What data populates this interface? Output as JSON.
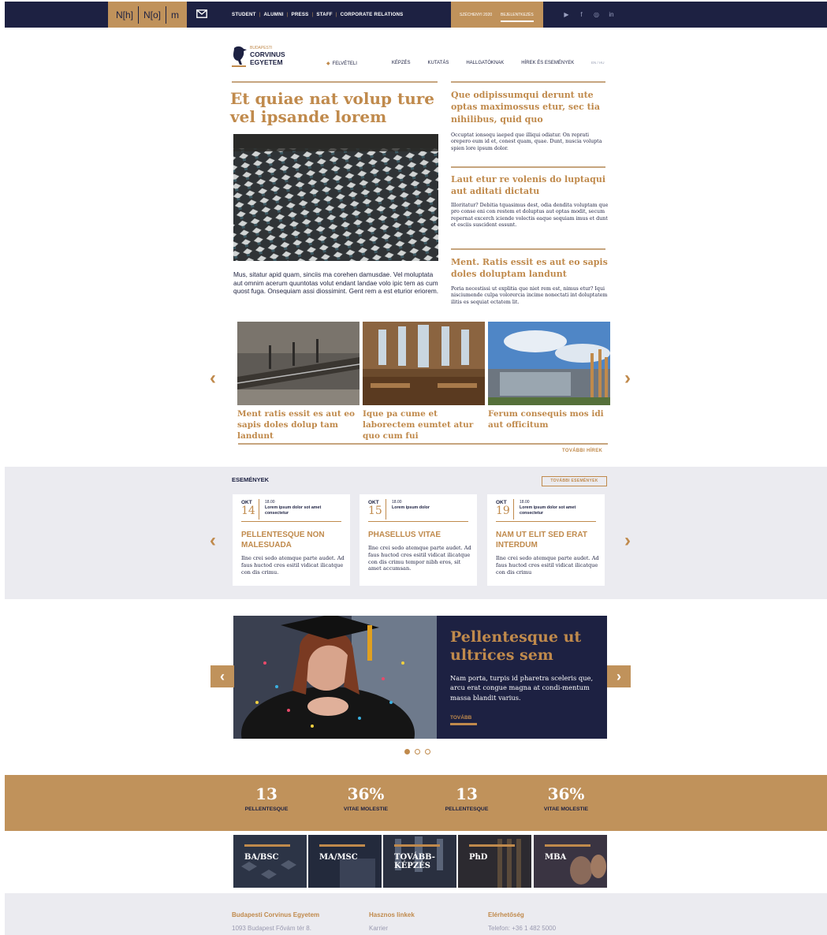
{
  "topbar": {
    "brand_letters": [
      "N[h]",
      "N[o]",
      "m"
    ],
    "links": [
      "STUDENT",
      "ALUMNI",
      "PRESS",
      "STAFF",
      "CORPORATE RELATIONS"
    ],
    "promo_label": "SZÉCHENYI 2020",
    "login_label": "BEJELENTKEZÉS",
    "social_icons": [
      "youtube-icon",
      "facebook-icon",
      "instagram-icon",
      "linkedin-icon"
    ]
  },
  "header": {
    "logo_line1": "BUDAPESTI",
    "logo_line2": "CORVINUS",
    "logo_line3": "EGYETEM",
    "nav": [
      "FELVÉTELI",
      "KÉPZÉS",
      "KUTATÁS",
      "HALLGATÓKNAK",
      "HÍREK ÉS ESEMÉNYEK"
    ],
    "lang": "EN / HU"
  },
  "hero": {
    "title": "Et quiae nat volup ture vel ipsande lorem",
    "text": "Mus, sitatur apid quam, sinciis ma corehen damusdae. Vel moluptata aut omnim acerum quuntotas volut endant landae volo ipic tem as cum quost fuga. Onsequiam assi diossimint. Gent rem a est eturior eriorem."
  },
  "side_news": [
    {
      "title": "Que odipissumqui derunt ute optas maximossus etur, sec tia nihilibus, quid quo",
      "text": "Occuptat ionsequ iaeped que illiqui odiatur. On reprati orepero eum id et, conest quam, quae. Dunt, nuscia volupta spien lore ipsum dolor."
    },
    {
      "title": "Laut etur re volenis do luptaqui aut aditati dictatu",
      "text": "Illoritatur? Debitia tquasimus dest, odia dendita voluptam que pro conse eni con restem et doluptus aut optas modit, secum repernat excerch iciende volectis eaque sequiam imus et dunt et esciis suscident essunt."
    },
    {
      "title": "Ment. Ratis essit es aut eo sapis doles doluptam landunt",
      "text": "Poria necestissi ut explitia que niet rem est, nimus etur? Iqui nisciumende culpa volorercia incime nonectati int doluptatem ilitis es sequiat ectatem lit."
    }
  ],
  "news_carousel": {
    "cards": [
      {
        "title": "Ment ratis essit es aut eo sapis doles dolup tam landunt"
      },
      {
        "title": "Ique pa cume et laborectem eumtet atur quo cum fui"
      },
      {
        "title": "Ferum consequis mos idi aut officitum"
      }
    ],
    "more_label": "TOVÁBBI HÍREK"
  },
  "events": {
    "title": "ESEMÉNYEK",
    "more_label": "TOVÁBBI ESEMÉNYEK",
    "items": [
      {
        "month": "OKT",
        "day": "14",
        "time": "18.00",
        "meta": "Lorem ipsum dolor sot amet consectetur",
        "title": "PELLENTESQUE NON MALESUADA",
        "text": "Ilne crei sedo atemque parte audet. Ad faus huctod cres esitil vidicat ilicatque con dis crimu."
      },
      {
        "month": "OKT",
        "day": "15",
        "time": "18.00",
        "meta": "Lorem ipsum dolor",
        "title": "PHASELLUS VITAE",
        "text": "Ilne crei sedo atemque parte audet. Ad faus huctod cres esitil vidicat ilicatque con dis crimu tempor nibh eros, sit amet accumsan."
      },
      {
        "month": "OKT",
        "day": "19",
        "time": "18.00",
        "meta": "Lorem ipsum dolor sot amet consectetur",
        "title": "NAM UT ELIT SED ERAT INTERDUM",
        "text": "Ilne crei sedo atemque parte audet. Ad faus huctod cres esitil vidicat ilicatque con dis crimu"
      }
    ]
  },
  "feature": {
    "title": "Pellentesque ut ultrices sem",
    "text": "Nam porta, turpis id pharetra sceleris que, arcu erat congue magna at condi-mentum massa blandit varius.",
    "more_label": "TOVÁBB",
    "active_dot": 1
  },
  "stats": [
    {
      "number": "13",
      "label": "PELLENTESQUE"
    },
    {
      "number": "36%",
      "label": "VITAE MOLESTIE"
    },
    {
      "number": "13",
      "label": "PELLENTESQUE"
    },
    {
      "number": "36%",
      "label": "VITAE MOLESTIE"
    }
  ],
  "programs": [
    "BA/BSC",
    "MA/MSC",
    "TOVÁBB-\nKÉPZÉS",
    "PhD",
    "MBA"
  ],
  "footer": {
    "col1_title": "Budapesti Corvinus Egyetem",
    "col1_text": "1093 Budapest Fővám tér 8.",
    "col2_title": "Hasznos linkek",
    "col2_text": "Karrier",
    "col3_title": "Elérhetőség",
    "col3_text": "Telefon: +36 1 482 5000"
  },
  "colors": {
    "navy": "#1d2142",
    "gold": "#c08a4c",
    "light_gray": "#ebebf0"
  }
}
